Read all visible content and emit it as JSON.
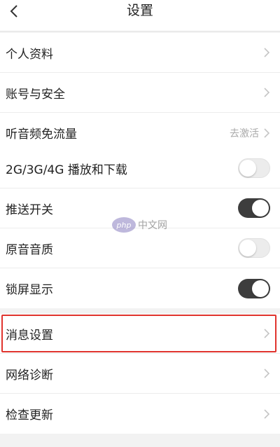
{
  "header": {
    "title": "设置"
  },
  "group1": {
    "items": [
      {
        "label": "个人资料"
      },
      {
        "label": "账号与安全"
      },
      {
        "label": "听音频免流量",
        "value": "去激活"
      }
    ]
  },
  "group2": {
    "items": [
      {
        "label": "2G/3G/4G 播放和下载",
        "toggle": "off"
      },
      {
        "label": "推送开关",
        "toggle": "on"
      },
      {
        "label": "原音音质",
        "toggle": "off"
      },
      {
        "label": "锁屏显示",
        "toggle": "on"
      }
    ]
  },
  "group3": {
    "items": [
      {
        "label": "消息设置"
      },
      {
        "label": "网络诊断"
      },
      {
        "label": "检查更新"
      }
    ]
  },
  "watermark": {
    "logo_text": "php",
    "text": "中文网"
  },
  "colors": {
    "highlight": "#e0342e",
    "toggle_on": "#3d3d3d",
    "toggle_off": "#ececec"
  }
}
